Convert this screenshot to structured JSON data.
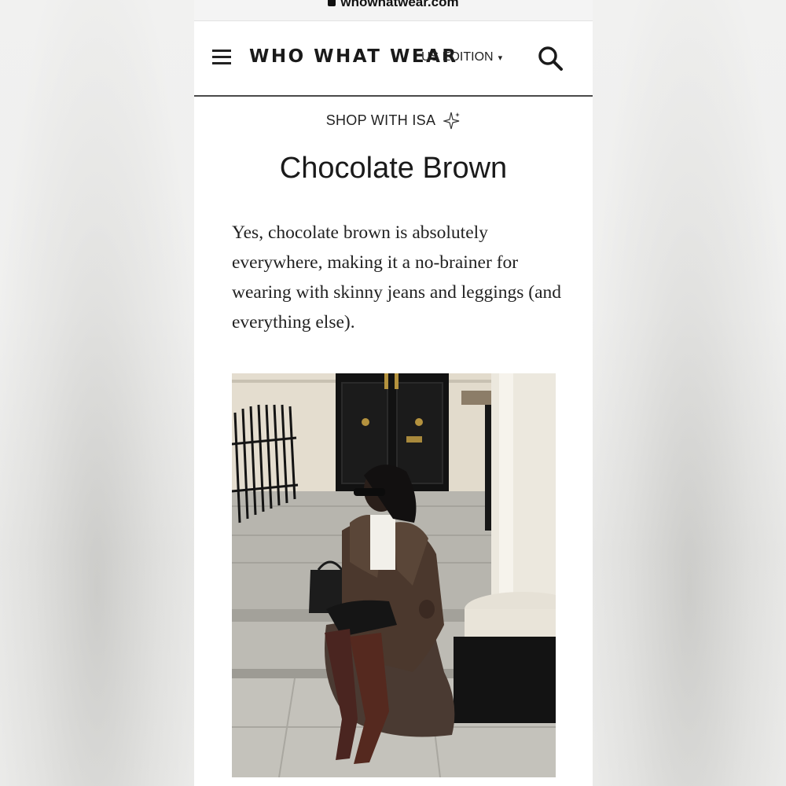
{
  "browser": {
    "url": "whowhatwear.com"
  },
  "header": {
    "logo": "WHO WHAT WEAR",
    "edition": "US EDITION",
    "edition_caret": "▾",
    "menu_icon": "hamburger-icon",
    "search_icon": "search-icon"
  },
  "article": {
    "section_label": "SHOP WITH ISA",
    "section_icon": "sparkle-icon",
    "title": "Chocolate Brown",
    "body": "Yes, chocolate brown is absolutely everywhere, making it a no-brainer for wearing with skinny jeans and leggings (and everything else)."
  },
  "photo": {
    "subject": "woman in brown shearling coat and croc-effect knee-high boots seated on stone steps"
  }
}
